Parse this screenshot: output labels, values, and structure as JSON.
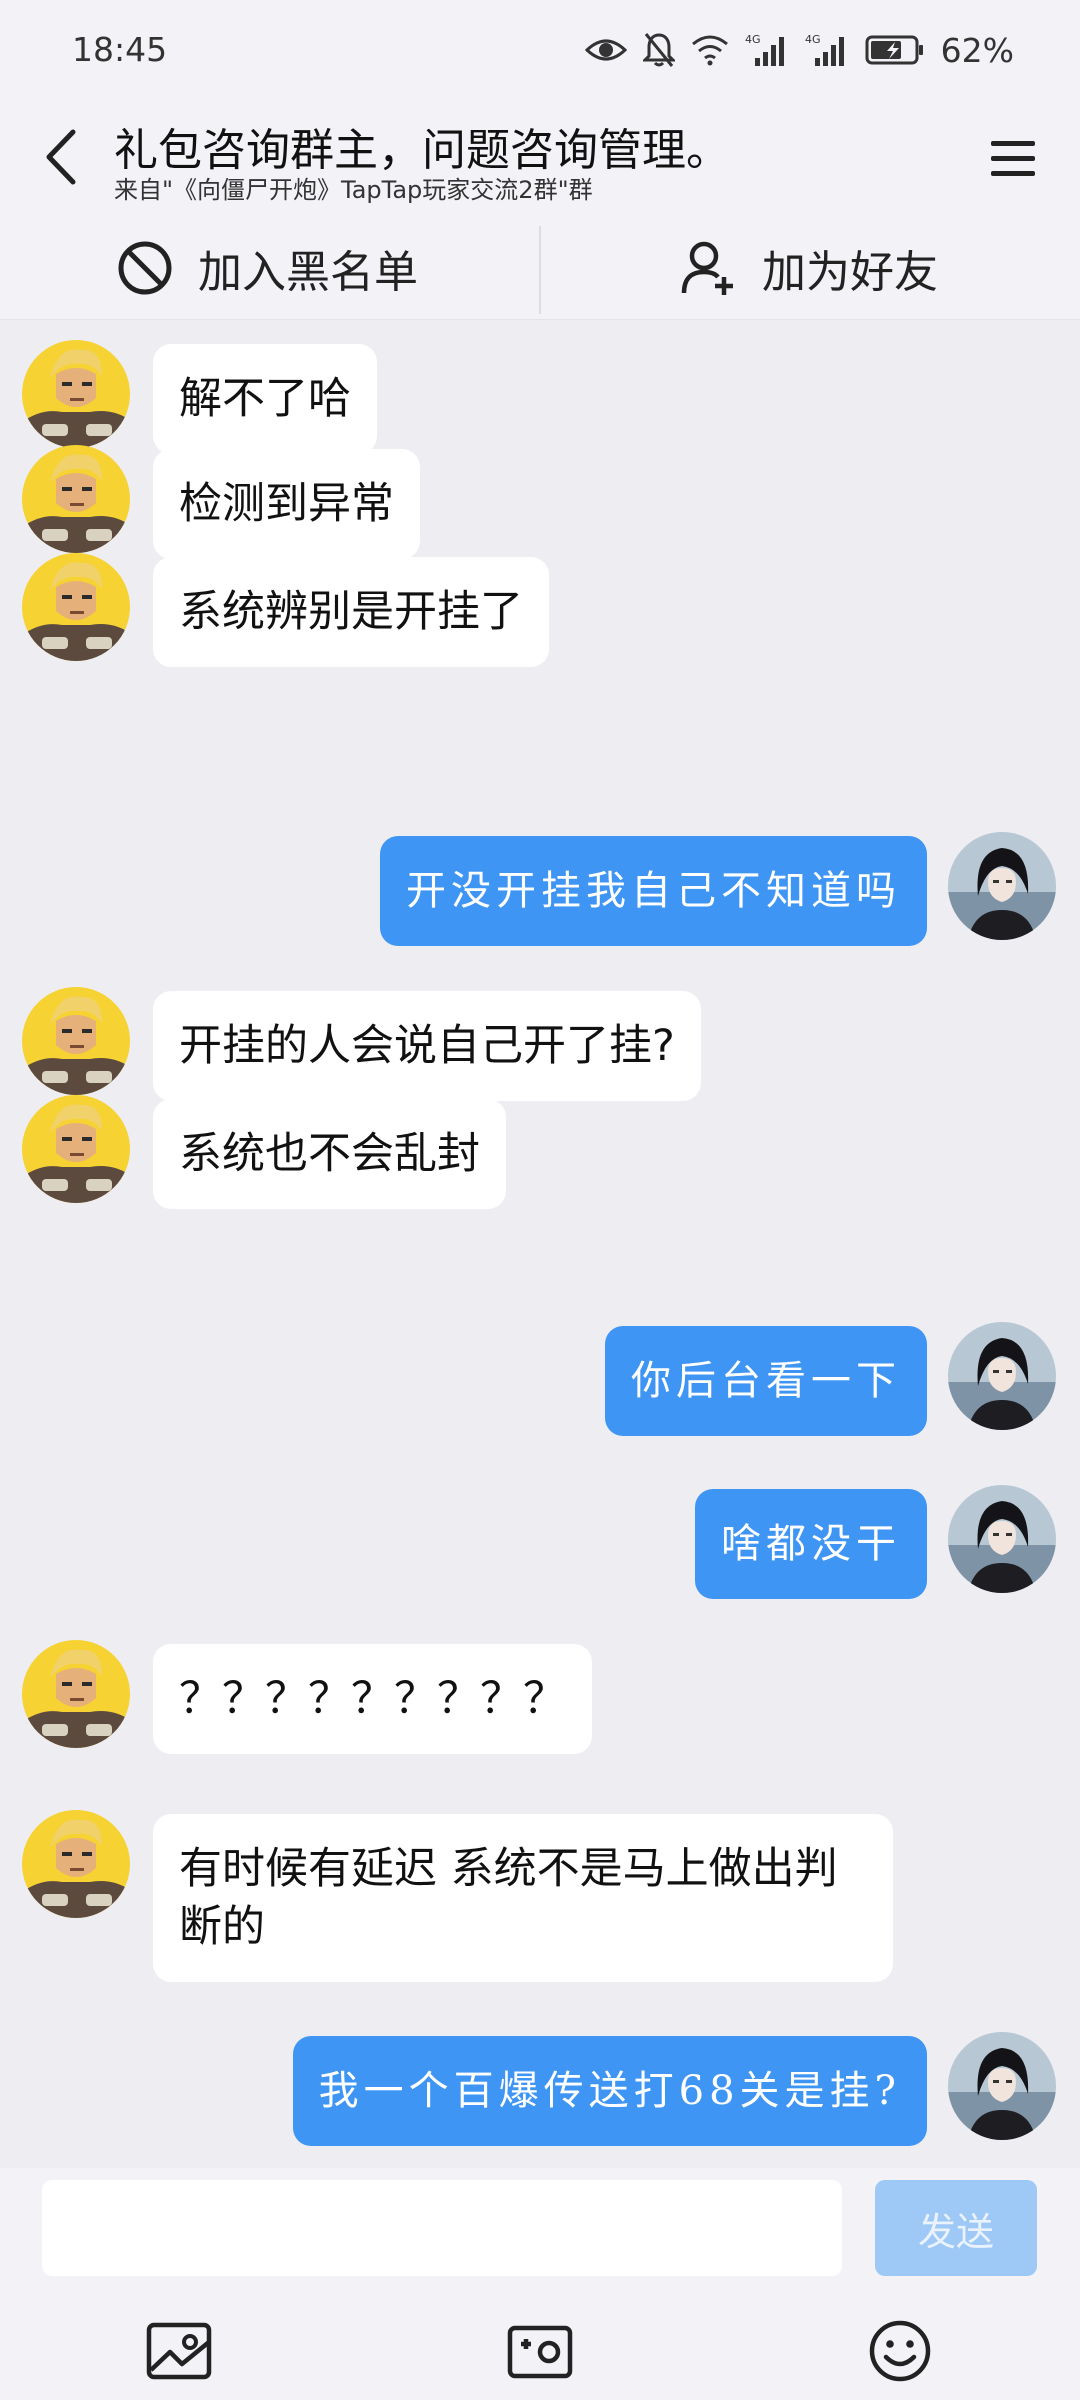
{
  "status_bar": {
    "time": "18:45",
    "battery": "62%",
    "icons": [
      "eye-icon",
      "mute-icon",
      "wifi-icon",
      "signal-4g-icon",
      "signal-4g-icon",
      "battery-icon"
    ]
  },
  "header": {
    "title": "礼包咨询群主，问题咨询管理。",
    "subtitle": "来自\"《向僵尸开炮》TapTap玩家交流2群\"群",
    "back_icon": "chevron-left-icon",
    "menu_icon": "hamburger-menu-icon"
  },
  "actions": {
    "blacklist": "加入黑名单",
    "add_friend": "加为好友"
  },
  "messages": [
    {
      "side": "left",
      "text": "解不了哈"
    },
    {
      "side": "left",
      "text": "检测到异常"
    },
    {
      "side": "left",
      "text": "系统辨别是开挂了"
    },
    {
      "side": "right",
      "text": "开没开挂我自己不知道吗"
    },
    {
      "side": "left",
      "text": "开挂的人会说自己开了挂?"
    },
    {
      "side": "left",
      "text": "系统也不会乱封"
    },
    {
      "side": "right",
      "text": "你后台看一下"
    },
    {
      "side": "right",
      "text": "啥都没干"
    },
    {
      "side": "left",
      "text": "？？？？？？？？？"
    },
    {
      "side": "left",
      "text": "有时候有延迟 系统不是马上做出判断的"
    },
    {
      "side": "right",
      "text": "我一个百爆传送打68关是挂?"
    }
  ],
  "input": {
    "placeholder": "",
    "send_label": "发送"
  },
  "colors": {
    "self_bubble": "#3f95f4",
    "other_bubble": "#ffffff",
    "background": "#ededf2",
    "send_disabled": "#9ec8f5"
  }
}
